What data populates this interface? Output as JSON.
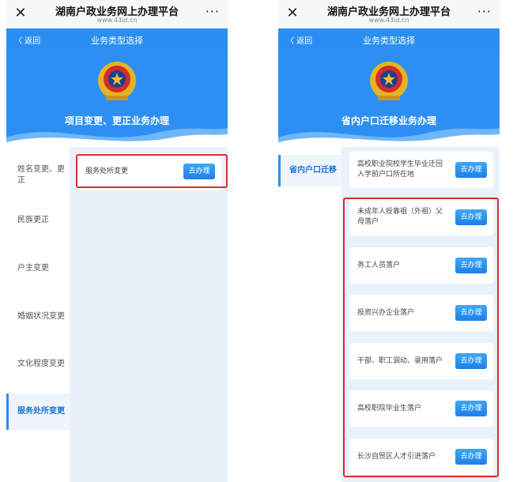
{
  "browser": {
    "title": "湖南户政业务网上办理平台",
    "url": "www.43id.cn",
    "more_label": "···",
    "close_label": "✕"
  },
  "nav": {
    "back_label": "〈 返回",
    "title": "业务类型选择"
  },
  "left_screen": {
    "hero_title": "项目变更、更正业务办理",
    "sidebar_items": [
      {
        "label": "姓名变更、更正",
        "active": false
      },
      {
        "label": "民族更正",
        "active": false
      },
      {
        "label": "户主变更",
        "active": false
      },
      {
        "label": "婚姻状况变更",
        "active": false
      },
      {
        "label": "文化程度变更",
        "active": false
      },
      {
        "label": "服务处所变更",
        "active": true
      }
    ],
    "cards": [
      {
        "label": "服务处所变更",
        "button": "去办理"
      }
    ]
  },
  "right_screen": {
    "hero_title": "省内户口迁移业务办理",
    "sidebar_items": [
      {
        "label": "省内户口迁移",
        "active": true
      }
    ],
    "cards": [
      {
        "label": "高校职业院校学生毕业迁回入学前户口所在地",
        "button": "去办理"
      },
      {
        "label": "未成年人投靠祖（外祖）父母落户",
        "button": "去办理"
      },
      {
        "label": "务工人员落户",
        "button": "去办理"
      },
      {
        "label": "投资兴办企业落户",
        "button": "去办理"
      },
      {
        "label": "干部、职工调动、录用落户",
        "button": "去办理"
      },
      {
        "label": "高校职院毕业生落户",
        "button": "去办理"
      },
      {
        "label": "长沙自贸区人才引进落户",
        "button": "去办理"
      }
    ]
  },
  "colors": {
    "primary": "#2b8ef3",
    "highlight": "#e02b2b",
    "content_bg": "#e9f2fb"
  }
}
